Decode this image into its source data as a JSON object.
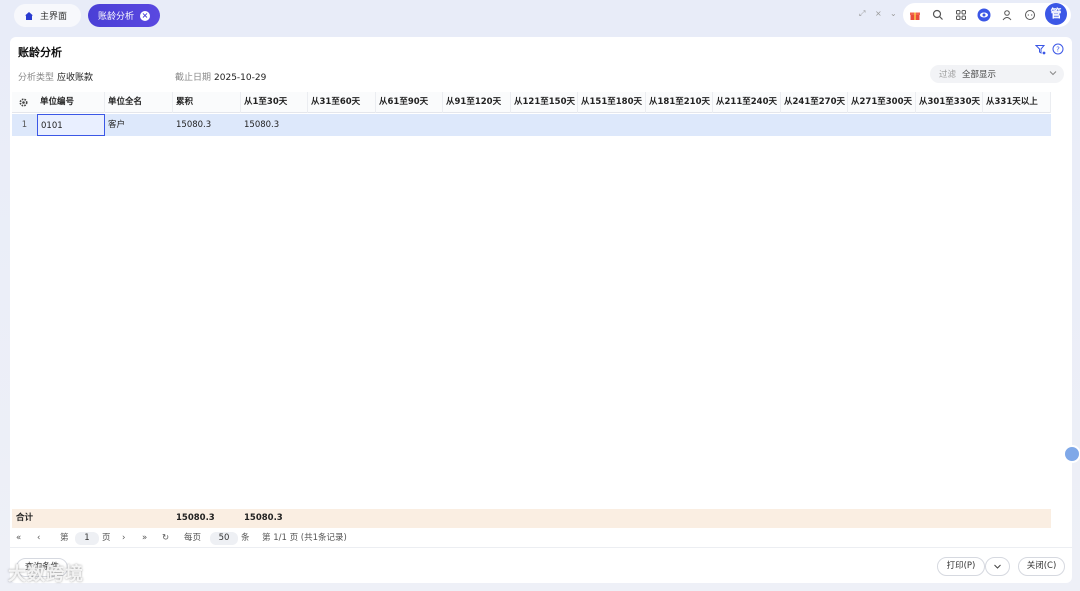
{
  "tabs": {
    "home_label": "主界面",
    "active_label": "账龄分析"
  },
  "header": {
    "title": "账龄分析",
    "analysis_type_label": "分析类型",
    "analysis_type_value": "应收账款",
    "deadline_label": "截止日期",
    "deadline_value": "2025-10-29",
    "filter_label": "过滤",
    "filter_value": "全部显示"
  },
  "user": {
    "avatar_text": "管"
  },
  "grid": {
    "columns": [
      "单位编号",
      "单位全名",
      "累积",
      "从1至30天",
      "从31至60天",
      "从61至90天",
      "从91至120天",
      "从121至150天",
      "从151至180天",
      "从181至210天",
      "从211至240天",
      "从241至270天",
      "从271至300天",
      "从301至330天",
      "从331天以上"
    ],
    "rows": [
      {
        "num": "1",
        "code": "0101",
        "name": "客户",
        "total": "15080.3",
        "d1_30": "15080.3"
      }
    ]
  },
  "totals": {
    "label": "合计",
    "total": "15080.3",
    "d1_30": "15080.3"
  },
  "pager": {
    "page_prefix": "第",
    "page_value": "1",
    "page_suffix": "页",
    "per_page_label": "每页",
    "per_page_value": "50",
    "per_page_unit": "条",
    "summary": "第 1/1 页 (共1条记录)"
  },
  "footer": {
    "query_label": "查询条件",
    "print_label": "打印(P)",
    "close_label": "关闭(C)",
    "watermark": "大数跨境"
  },
  "colors": {
    "accent": "#4a3fd6",
    "row_highlight": "#dde8fb",
    "totals_bg": "#faeee2"
  }
}
